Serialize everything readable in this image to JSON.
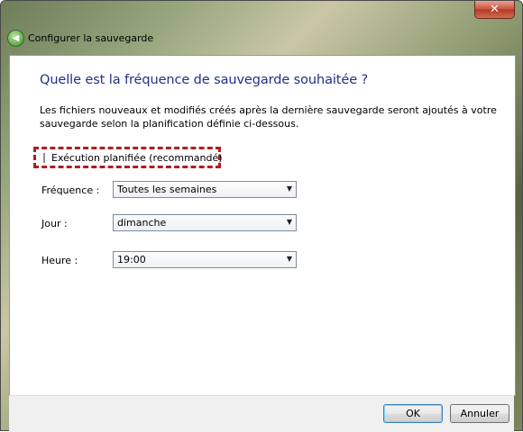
{
  "window": {
    "title": "Configurer la sauvegarde",
    "close_glyph": "✕"
  },
  "main": {
    "heading": "Quelle est la fréquence de sauvegarde souhaitée ?",
    "description": "Les fichiers nouveaux et modifiés créés après la dernière sauvegarde seront ajoutés à votre sauvegarde selon la planification définie ci-dessous.",
    "scheduled": {
      "label": "Exécution planifiée (recommandé)",
      "checked": false
    },
    "fields": {
      "frequency": {
        "label": "Fréquence :",
        "value": "Toutes les semaines"
      },
      "day": {
        "label": "Jour :",
        "value": "dimanche"
      },
      "time": {
        "label": "Heure :",
        "value": "19:00"
      }
    }
  },
  "footer": {
    "ok_label": "OK",
    "cancel_label": "Annuler"
  },
  "icons": {
    "back": "back-arrow-icon",
    "close": "close-icon",
    "dropdown": "chevron-down-icon"
  },
  "colors": {
    "heading": "#1e3287",
    "highlight_border": "#b01e1e"
  }
}
